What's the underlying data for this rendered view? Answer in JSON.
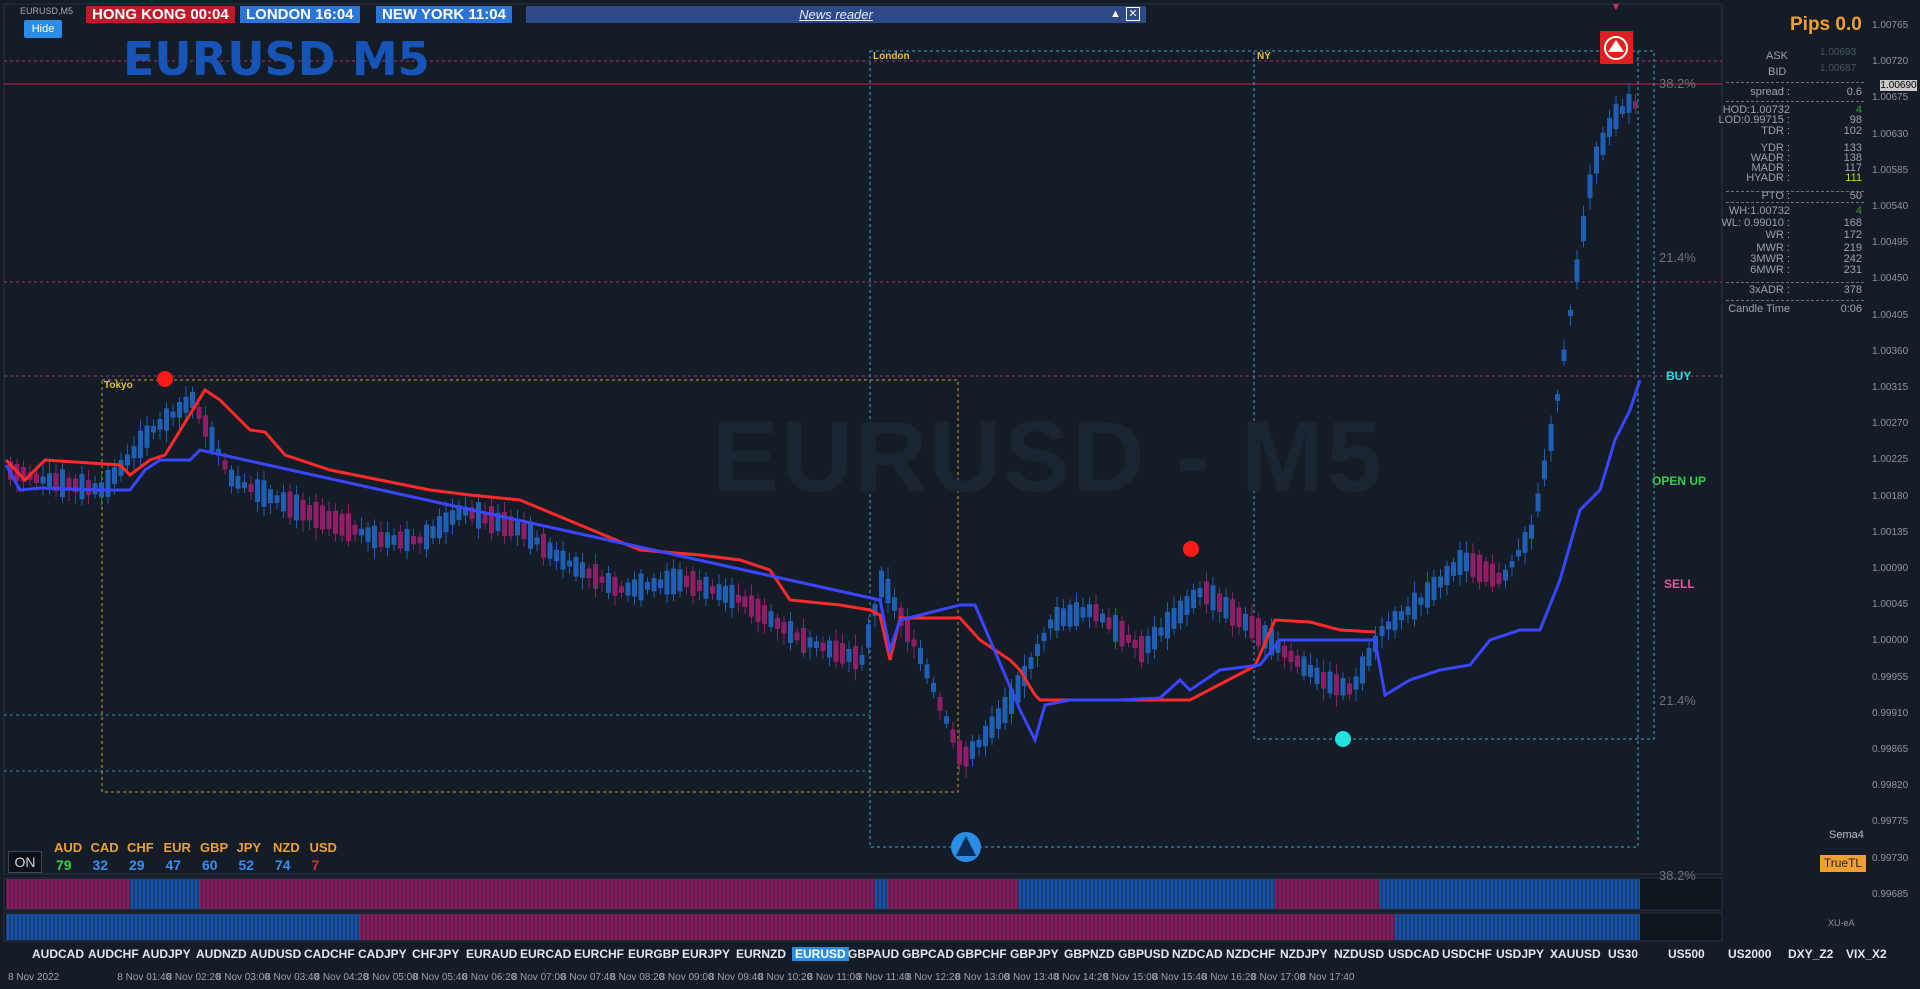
{
  "window": {
    "symbol_tab": "EURUSD,M5"
  },
  "clocks": [
    {
      "label": "HONG KONG 00:04",
      "bg": "#c0192b"
    },
    {
      "label": "LONDON  16:04",
      "bg": "#2b74d8"
    },
    {
      "label": "NEW YORK 11:04",
      "bg": "#2b74d8"
    }
  ],
  "news_reader": {
    "title": "News reader",
    "minimize_icon": "triangle-up-icon",
    "close_icon": "close-icon"
  },
  "hide_button": "Hide",
  "chart_title": "EURUSD M5",
  "watermark": "EURUSD - M5",
  "sessions": [
    "Tokyo",
    "London",
    "NY"
  ],
  "fib_levels": [
    "38.2%",
    "21.4%",
    "21.4%",
    "38.2%"
  ],
  "signals": {
    "buy": "BUY",
    "open_up": "OPEN UP",
    "sell": "SELL"
  },
  "pips": "Pips 0.0",
  "quote": {
    "ask_label": "ASK",
    "ask": "1.00693",
    "bid_label": "BID",
    "bid": "1.00687"
  },
  "stats": [
    {
      "label": "spread :",
      "value": "0.6",
      "color": "#9aa3ad"
    },
    {
      "label": "HOD:1.00732",
      "value": "4",
      "color": "#3a9a3a"
    },
    {
      "label": "LOD:0.99715 :",
      "value": "98",
      "color": "#9aa3ad"
    },
    {
      "label": "TDR :",
      "value": "102",
      "color": "#9aa3ad"
    },
    {
      "label": "YDR :",
      "value": "133",
      "color": "#9aa3ad"
    },
    {
      "label": "WADR :",
      "value": "138",
      "color": "#9aa3ad"
    },
    {
      "label": "MADR :",
      "value": "117",
      "color": "#9aa3ad"
    },
    {
      "label": "HYADR :",
      "value": "111",
      "color": "#b8e02a"
    },
    {
      "label": "PTO :",
      "value": "50",
      "color": "#9aa3ad"
    },
    {
      "label": "WH:1.00732",
      "value": "4",
      "color": "#3a9a3a"
    },
    {
      "label": "WL: 0.99010 :",
      "value": "168",
      "color": "#9aa3ad"
    },
    {
      "label": "WR :",
      "value": "172",
      "color": "#9aa3ad"
    },
    {
      "label": "MWR :",
      "value": "219",
      "color": "#9aa3ad"
    },
    {
      "label": "3MWR :",
      "value": "242",
      "color": "#9aa3ad"
    },
    {
      "label": "6MWR :",
      "value": "231",
      "color": "#9aa3ad"
    },
    {
      "label": "3xADR :",
      "value": "378",
      "color": "#9aa3ad"
    },
    {
      "label": "Candle Time",
      "value": "0:06",
      "color": "#9aa3ad"
    }
  ],
  "price_scale": [
    "1.00765",
    "1.00720",
    "1.00675",
    "1.00630",
    "1.00585",
    "1.00540",
    "1.00495",
    "1.00450",
    "1.00405",
    "1.00360",
    "1.00315",
    "1.00270",
    "1.00225",
    "1.00180",
    "1.00135",
    "1.00090",
    "1.00045",
    "1.00000",
    "0.99955",
    "0.99910",
    "0.99865",
    "0.99820",
    "0.99775",
    "0.99730",
    "0.99685"
  ],
  "current_price_tag": "1.00690",
  "currency_strength": [
    {
      "code": "AUD",
      "value": "79",
      "color": "#2fd04a"
    },
    {
      "code": "CAD",
      "value": "32",
      "color": "#3a8ef0"
    },
    {
      "code": "CHF",
      "value": "29",
      "color": "#3a8ef0"
    },
    {
      "code": "EUR",
      "value": "47",
      "color": "#3a8ef0"
    },
    {
      "code": "GBP",
      "value": "60",
      "color": "#3a8ef0"
    },
    {
      "code": "JPY",
      "value": "52",
      "color": "#3a8ef0"
    },
    {
      "code": "NZD",
      "value": "74",
      "color": "#3a8ef0"
    },
    {
      "code": "USD",
      "value": "7",
      "color": "#e03030"
    }
  ],
  "on_button": "ON",
  "sema_label": "Sema4",
  "truetl_button": "TrueTL",
  "xu_label": "XU-eA",
  "symbols": [
    "AUDCAD",
    "AUDCHF",
    "AUDJPY",
    "AUDNZD",
    "AUDUSD",
    "CADCHF",
    "CADJPY",
    "CHFJPY",
    "EURAUD",
    "EURCAD",
    "EURCHF",
    "EURGBP",
    "EURJPY",
    "EURNZD",
    "EURUSD",
    "GBPAUD",
    "GBPCAD",
    "GBPCHF",
    "GBPJPY",
    "GBPNZD",
    "GBPUSD",
    "NZDCAD",
    "NZDCHF",
    "NZDJPY",
    "NZDUSD",
    "USDCAD",
    "USDCHF",
    "USDJPY",
    "XAUUSD",
    "US30",
    "US500",
    "US2000",
    "DXY_Z2",
    "VIX_X2"
  ],
  "active_symbol": "EURUSD",
  "time_axis": [
    "8 Nov 2022",
    "8 Nov 01:40",
    "8 Nov 02:20",
    "8 Nov 03:00",
    "8 Nov 03:40",
    "8 Nov 04:20",
    "8 Nov 05:00",
    "8 Nov 05:40",
    "8 Nov 06:20",
    "8 Nov 07:00",
    "8 Nov 07:40",
    "8 Nov 08:20",
    "8 Nov 09:00",
    "8 Nov 09:40",
    "8 Nov 10:20",
    "8 Nov 11:00",
    "8 Nov 11:40",
    "8 Nov 12:20",
    "8 Nov 13:00",
    "8 Nov 13:40",
    "8 Nov 14:20",
    "8 Nov 15:00",
    "8 Nov 15:40",
    "8 Nov 16:20",
    "8 Nov 17:00",
    "8 Nov 17:40"
  ],
  "colors": {
    "bull": "#1f5fb4",
    "bear": "#8e1f66",
    "red_line": "#ff2a2a",
    "blue_line": "#3a46ff",
    "background": "#131c27"
  }
}
